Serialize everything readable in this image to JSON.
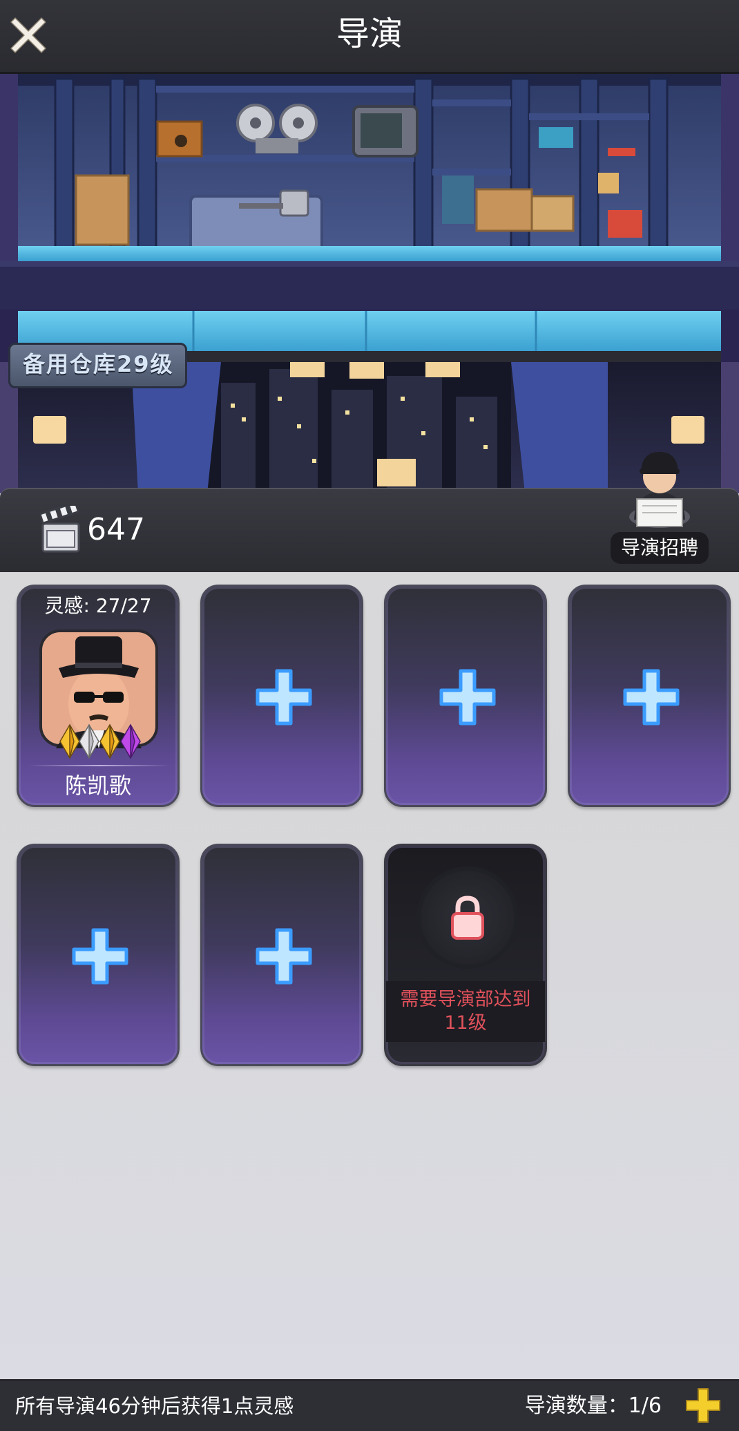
{
  "header": {
    "title": "导演",
    "close_icon": "close-icon"
  },
  "scene": {
    "warehouse_label": "备用仓库29级"
  },
  "resource": {
    "icon": "clapperboard-icon",
    "value": "647",
    "recruit_label": "导演招聘"
  },
  "slots": {
    "director": {
      "inspiration": "灵感: 27/27",
      "name": "陈凯歌",
      "gems": [
        "gold",
        "silver",
        "gold",
        "purple"
      ]
    },
    "empty_icon": "plus-icon",
    "locked_text": "需要导演部达到11级"
  },
  "footer": {
    "info": "所有导演46分钟后获得1点灵感",
    "count": "导演数量：1/6",
    "add_icon": "plus-icon"
  },
  "colors": {
    "card_purple": "#6a54a6",
    "plus_blue": "#5ab4ff",
    "lock_red": "#e0515b",
    "add_yellow": "#f4cf2c"
  }
}
